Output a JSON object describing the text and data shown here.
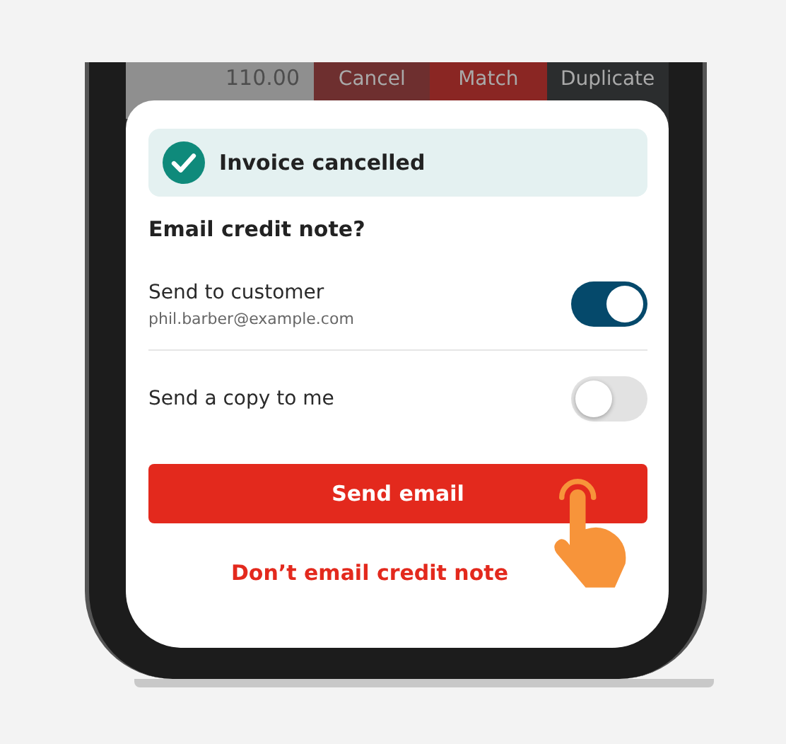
{
  "background_row": {
    "amount": "110.00",
    "actions": [
      {
        "label": "Cancel",
        "kind": "cancel"
      },
      {
        "label": "Match",
        "kind": "match"
      },
      {
        "label": "Duplicate",
        "kind": "duplicate"
      }
    ]
  },
  "banner": {
    "text": "Invoice cancelled"
  },
  "sheet": {
    "title": "Email credit note?",
    "options": [
      {
        "label": "Send to customer",
        "detail": "phil.barber@example.com",
        "on": true
      },
      {
        "label": "Send a copy to me",
        "on": false
      }
    ],
    "primary_button": "Send email",
    "secondary_link": "Don’t email credit note"
  }
}
